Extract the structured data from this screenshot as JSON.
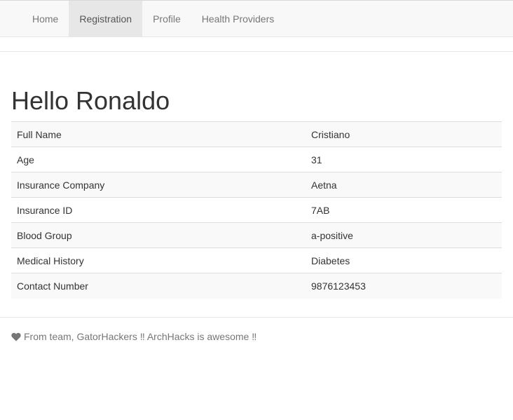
{
  "nav": {
    "items": [
      {
        "label": "Home",
        "active": false
      },
      {
        "label": "Registration",
        "active": true
      },
      {
        "label": "Profile",
        "active": false
      },
      {
        "label": "Health Providers",
        "active": false
      }
    ]
  },
  "greeting": "Hello Ronaldo",
  "details": {
    "rows": [
      {
        "label": "Full Name",
        "value": "Cristiano"
      },
      {
        "label": "Age",
        "value": "31"
      },
      {
        "label": "Insurance Company",
        "value": "Aetna"
      },
      {
        "label": "Insurance ID",
        "value": "7AB"
      },
      {
        "label": "Blood Group",
        "value": "a-positive"
      },
      {
        "label": "Medical History",
        "value": "Diabetes"
      },
      {
        "label": "Contact Number",
        "value": "9876123453"
      }
    ]
  },
  "footer": {
    "icon": "heart-icon",
    "text": "From team, GatorHackers ‼ ArchHacks is awesome ‼"
  },
  "colors": {
    "navbar_bg": "#f8f8f8",
    "nav_active_bg": "#e7e7e7",
    "nav_text": "#777777",
    "striped_row": "#f9f9f9"
  }
}
